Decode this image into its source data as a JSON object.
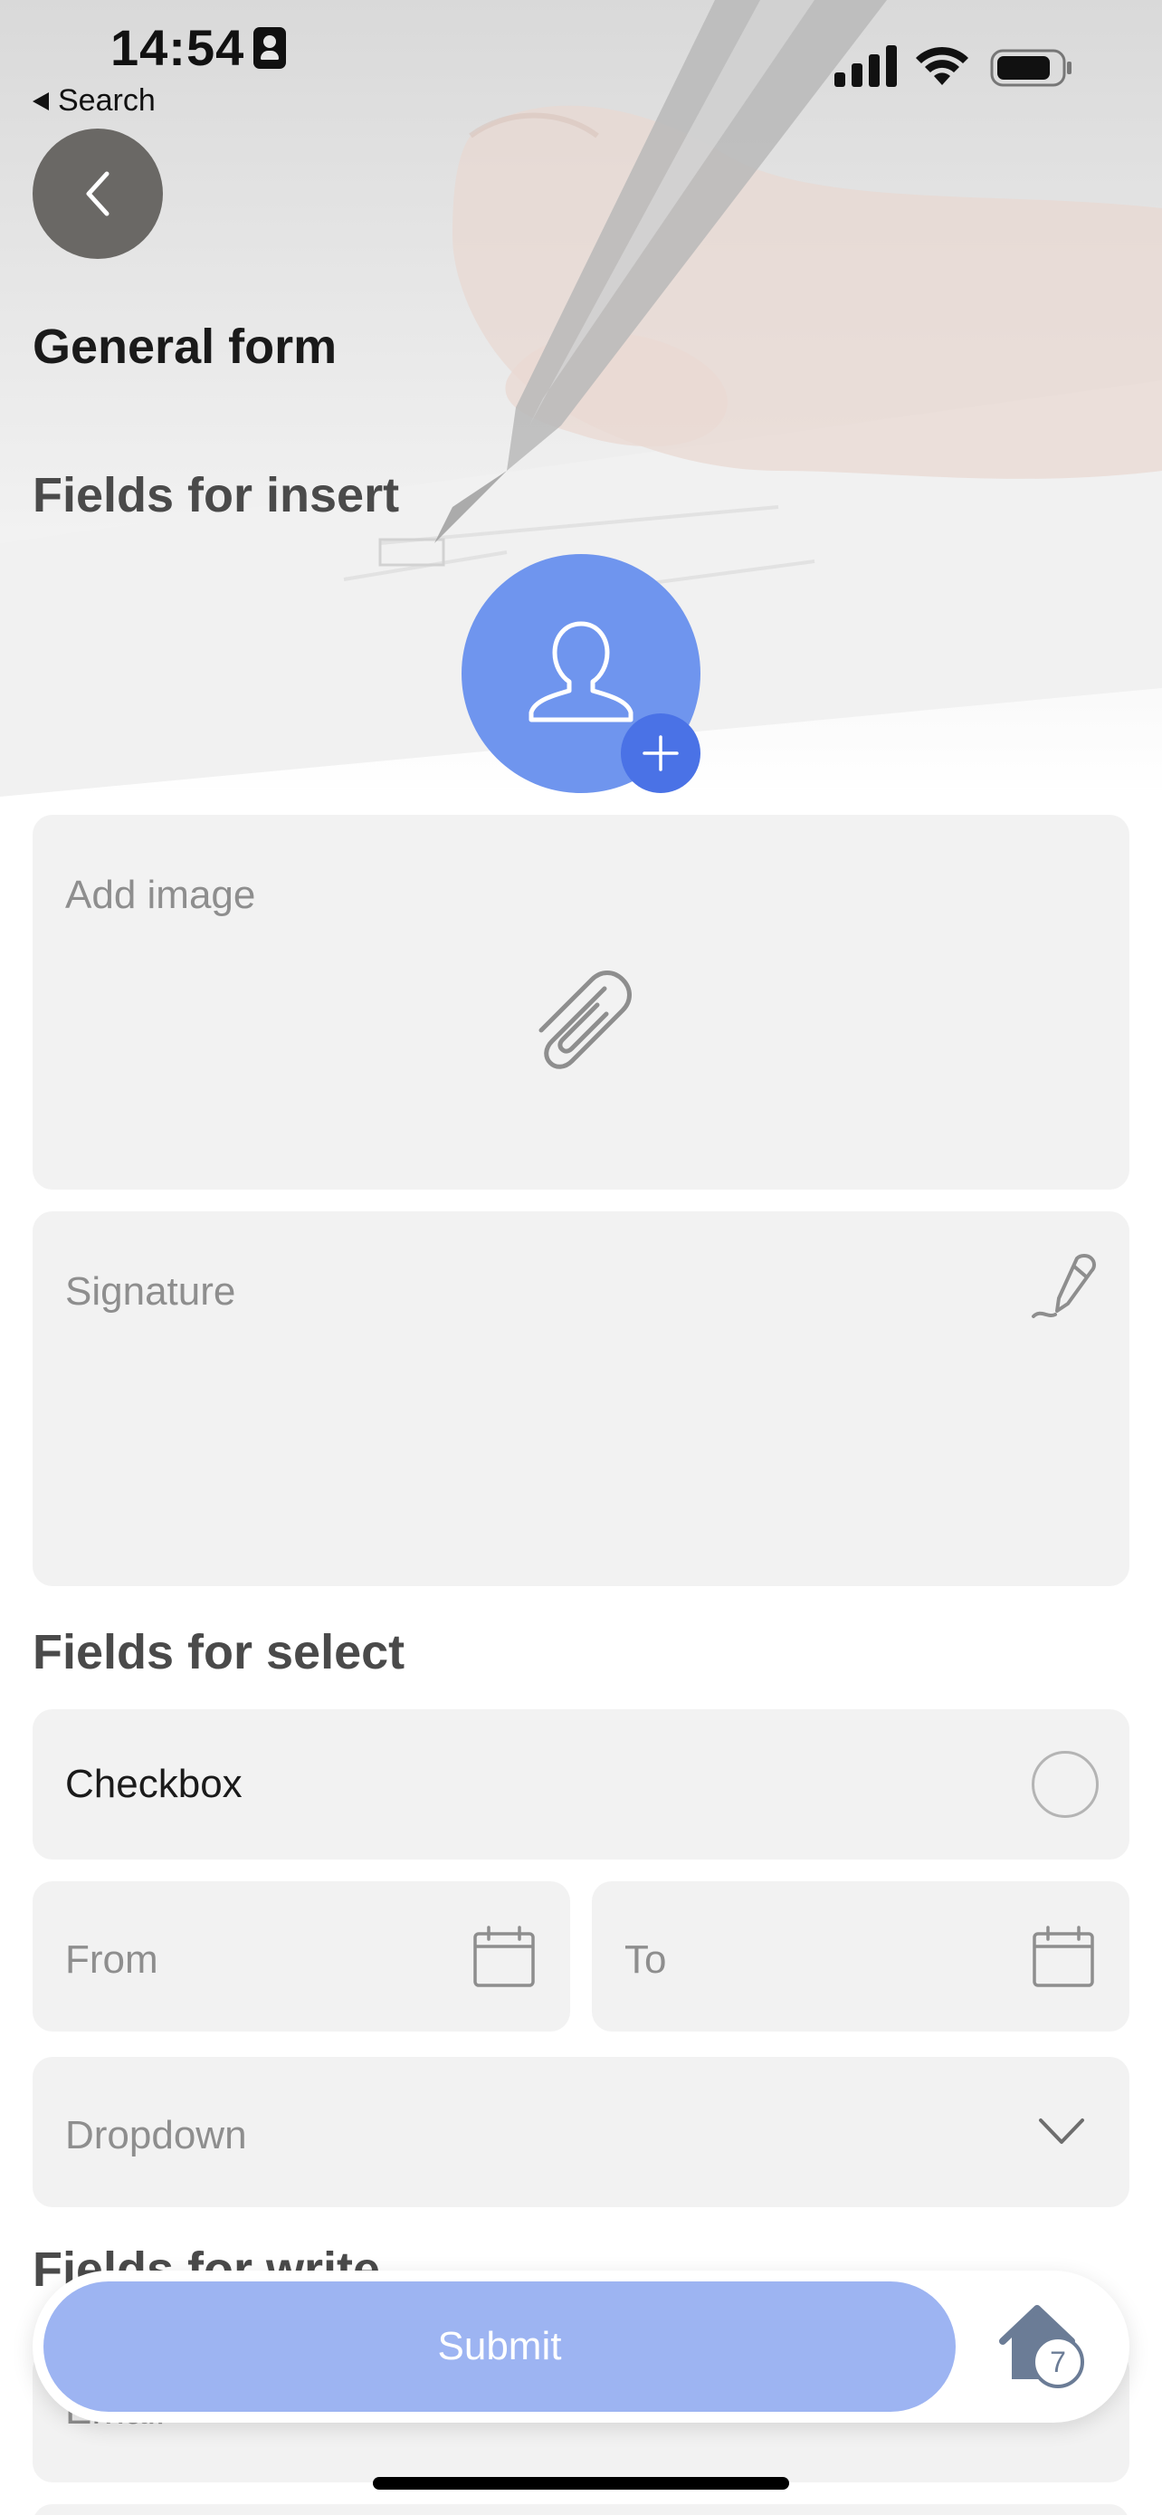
{
  "status_bar": {
    "time": "14:54",
    "back_app": "Search"
  },
  "header": {
    "title": "General form"
  },
  "sections": {
    "insert": "Fields for insert",
    "select": "Fields for select",
    "write": "Fields for write"
  },
  "fields": {
    "add_image": "Add image",
    "signature": "Signature",
    "checkbox": "Checkbox",
    "from": "From",
    "to": "To",
    "dropdown": "Dropdown",
    "email": "Email"
  },
  "actions": {
    "submit": "Submit",
    "home_badge": "7"
  },
  "colors": {
    "accent": "#6f95ee",
    "accent_dark": "#4a72e6",
    "submit_bg": "#9db4f2",
    "field_bg": "#f2f2f2",
    "placeholder": "#8e8e8e"
  },
  "icons": [
    "back-chevron-icon",
    "user-icon",
    "plus-icon",
    "paperclip-icon",
    "pen-signature-icon",
    "radio-circle-icon",
    "calendar-icon",
    "chevron-down-icon",
    "home-icon"
  ]
}
